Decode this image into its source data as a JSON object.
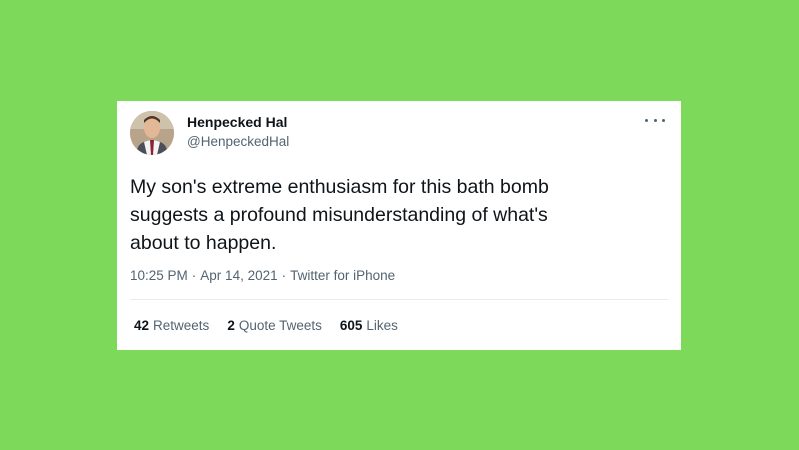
{
  "tweet": {
    "author_name": "Henpecked Hal",
    "author_handle": "@HenpeckedHal",
    "text": "My son's extreme enthusiasm for this bath bomb\nsuggests a profound misunderstanding of what's\nabout to happen.",
    "time": "10:25 PM",
    "date": "Apr 14, 2021",
    "source": "Twitter for iPhone",
    "separator": "·",
    "stats": {
      "retweets_count": "42",
      "retweets_label": "Retweets",
      "quote_count": "2",
      "quote_label": "Quote Tweets",
      "likes_count": "605",
      "likes_label": "Likes"
    }
  },
  "colors": {
    "background": "#7dd95a",
    "card": "#ffffff",
    "primary_text": "#0f1419",
    "secondary_text": "#536471"
  },
  "icons": {
    "more": "more-options-icon"
  }
}
